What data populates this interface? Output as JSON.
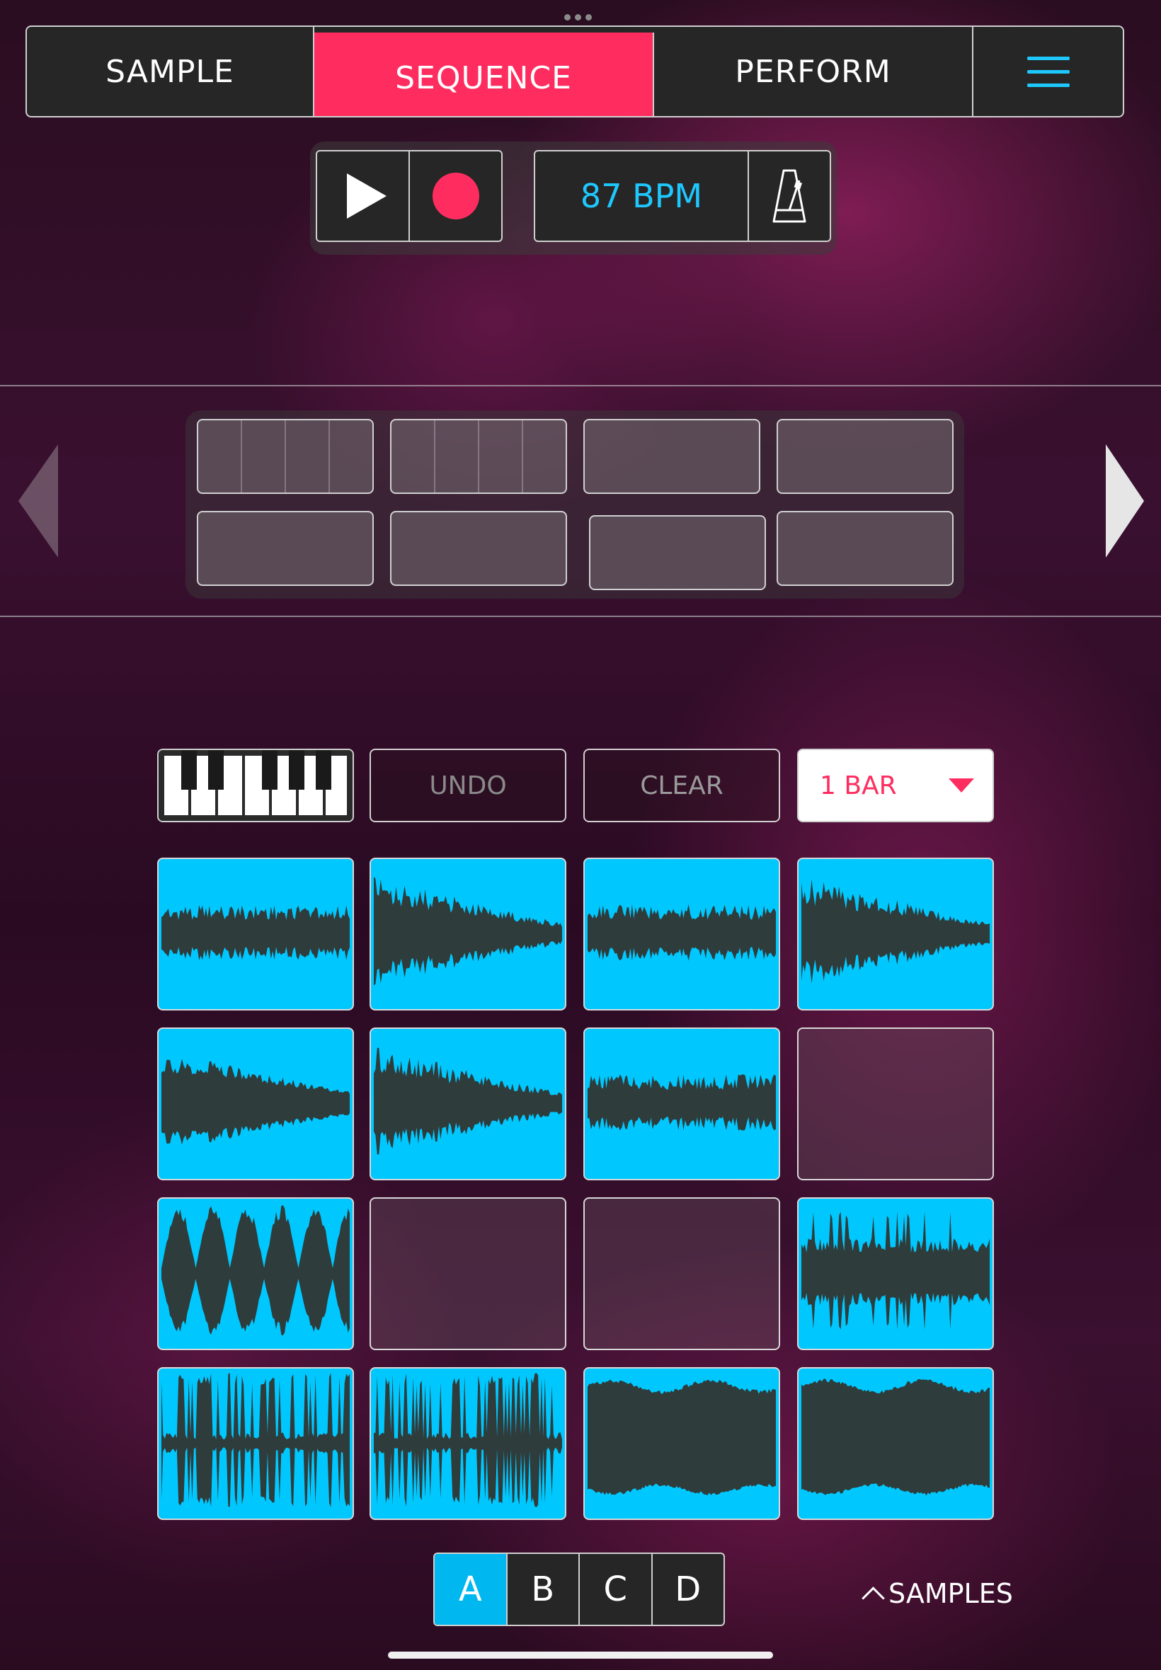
{
  "nav": {
    "tabs": [
      {
        "label": "SAMPLE",
        "active": false
      },
      {
        "label": "SEQUENCE",
        "active": true
      },
      {
        "label": "PERFORM",
        "active": false
      }
    ],
    "menu_icon": "hamburger-menu-icon",
    "accent_color": "#ff2d5f",
    "menu_color": "#1ec8ff"
  },
  "transport": {
    "play_icon": "play-icon",
    "record_icon": "record-icon",
    "bpm_label": "87 BPM",
    "metronome_icon": "metronome-icon"
  },
  "patterns": {
    "count": 8,
    "prev_icon": "arrow-left-icon",
    "next_icon": "arrow-right-icon"
  },
  "controls": {
    "piano_icon": "piano-keyboard-icon",
    "undo_label": "UNDO",
    "clear_label": "CLEAR",
    "bar_label": "1 BAR",
    "dropdown_icon": "triangle-down-icon"
  },
  "pads": {
    "pad_color": "#00c8ff",
    "wave_color": "#2f3c3c",
    "loaded": [
      true,
      true,
      true,
      true,
      true,
      true,
      true,
      false,
      true,
      false,
      false,
      true,
      true,
      true,
      true,
      true
    ]
  },
  "banks": {
    "items": [
      "A",
      "B",
      "C",
      "D"
    ],
    "active": "A"
  },
  "samples": {
    "label": "SAMPLES",
    "icon": "chevron-up-icon"
  }
}
